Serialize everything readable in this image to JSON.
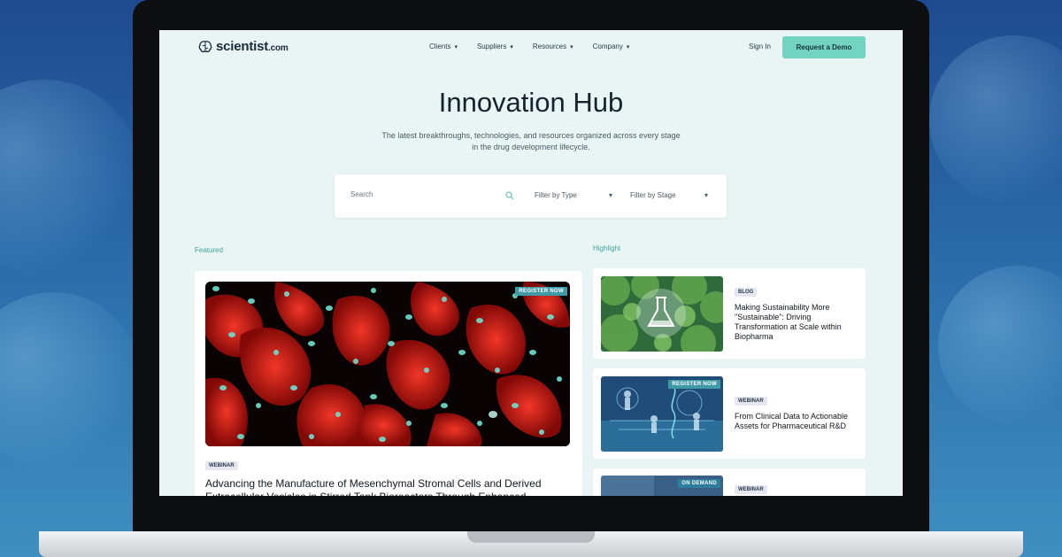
{
  "brand": {
    "name": "scientist",
    "suffix": ".com"
  },
  "nav": {
    "items": [
      {
        "label": "Clients"
      },
      {
        "label": "Suppliers"
      },
      {
        "label": "Resources"
      },
      {
        "label": "Company"
      }
    ],
    "sign_in": "Sign In",
    "cta": "Request a Demo"
  },
  "hero": {
    "title": "Innovation Hub",
    "subtitle": "The latest breakthroughs, technologies, and resources organized across every stage in the drug development lifecycle."
  },
  "search": {
    "placeholder": "Search",
    "filter_type": "Filter by Type",
    "filter_stage": "Filter by Stage"
  },
  "featured": {
    "label": "Featured",
    "badge": "REGISTER NOW",
    "tag": "WEBINAR",
    "title": "Advancing the Manufacture of Mesenchymal Stromal Cells and Derived Extracellular Vesicles in Stirred Tank Bioreactors Through Enhanced"
  },
  "highlight": {
    "label": "Highlight",
    "items": [
      {
        "tag": "BLOG",
        "badge": "",
        "title": "Making Sustainability More \"Sustainable\": Driving Transformation at Scale within Biopharma"
      },
      {
        "tag": "WEBINAR",
        "badge": "REGISTER NOW",
        "title": "From Clinical Data to Actionable Assets for Pharmaceutical R&D"
      },
      {
        "tag": "WEBINAR",
        "badge": "ON DEMAND",
        "title": ""
      }
    ]
  },
  "colors": {
    "accent": "#72d3c0",
    "label": "#3fa39a",
    "background": "#e9f5f5"
  }
}
